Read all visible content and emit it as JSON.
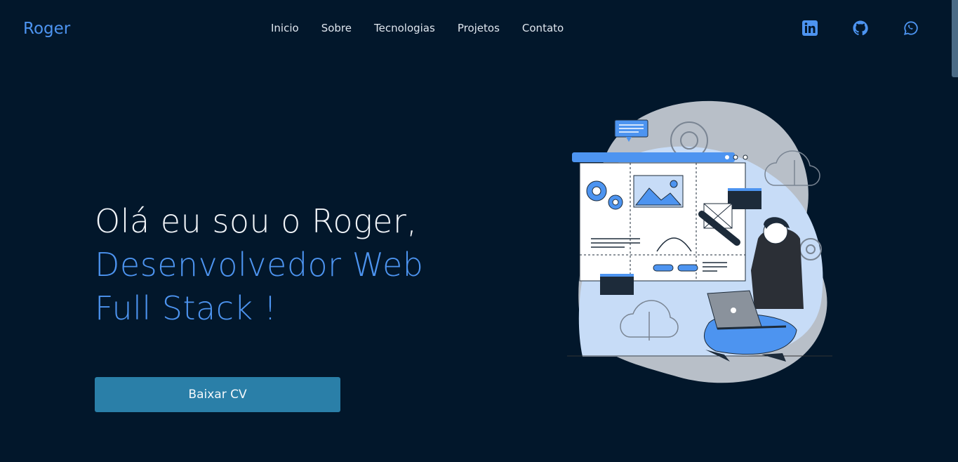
{
  "header": {
    "logo": "Roger",
    "nav": [
      "Inicio",
      "Sobre",
      "Tecnologias",
      "Projetos",
      "Contato"
    ],
    "socials": [
      {
        "icon": "linkedin-icon"
      },
      {
        "icon": "github-icon"
      },
      {
        "icon": "whatsapp-icon"
      }
    ]
  },
  "hero": {
    "line1": "Olá eu sou o Roger,",
    "line2": "Desenvolvedor Web",
    "line3": "Full Stack !",
    "cv_button": "Baixar CV"
  },
  "colors": {
    "background": "#02172b",
    "accent": "#4d94f0",
    "button": "#2a7fa8"
  }
}
